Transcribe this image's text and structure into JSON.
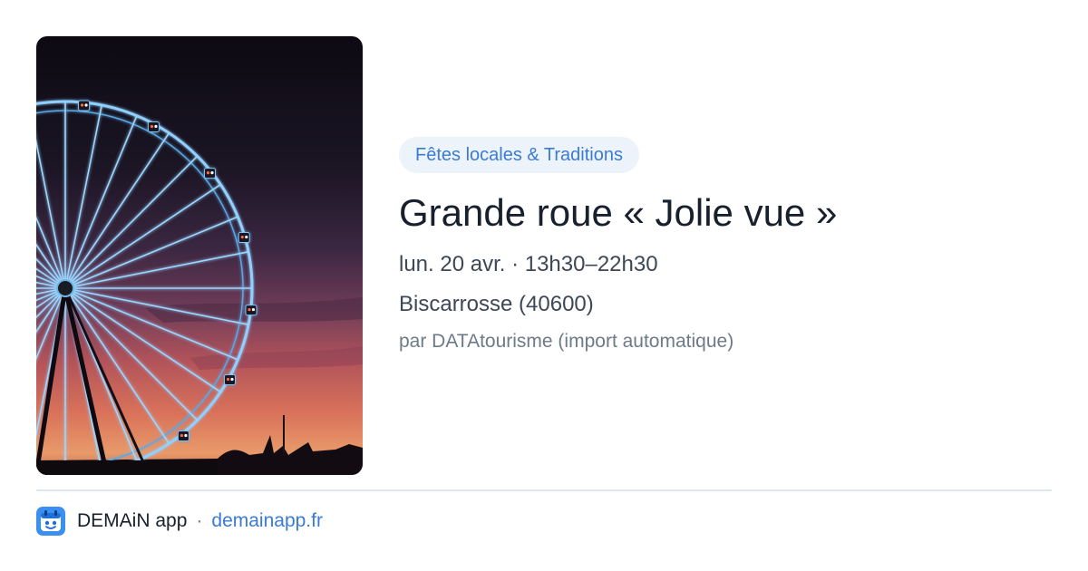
{
  "event": {
    "category": "Fêtes locales & Traditions",
    "title": "Grande roue « Jolie vue »",
    "datetime": "lun. 20 avr. · 13h30–22h30",
    "location": "Biscarrosse (40600)",
    "source": "par DATAtourisme (import automatique)"
  },
  "footer": {
    "app_name": "DEMAiN app",
    "separator": "·",
    "url": "demainapp.fr",
    "logo_icon": "demain-app-logo-icon"
  },
  "colors": {
    "accent": "#3a7bd5",
    "badge_bg": "#edf3fb",
    "title": "#17202c",
    "body": "#3d4856",
    "muted": "#6d7a88",
    "divider": "#dfe7ee"
  }
}
